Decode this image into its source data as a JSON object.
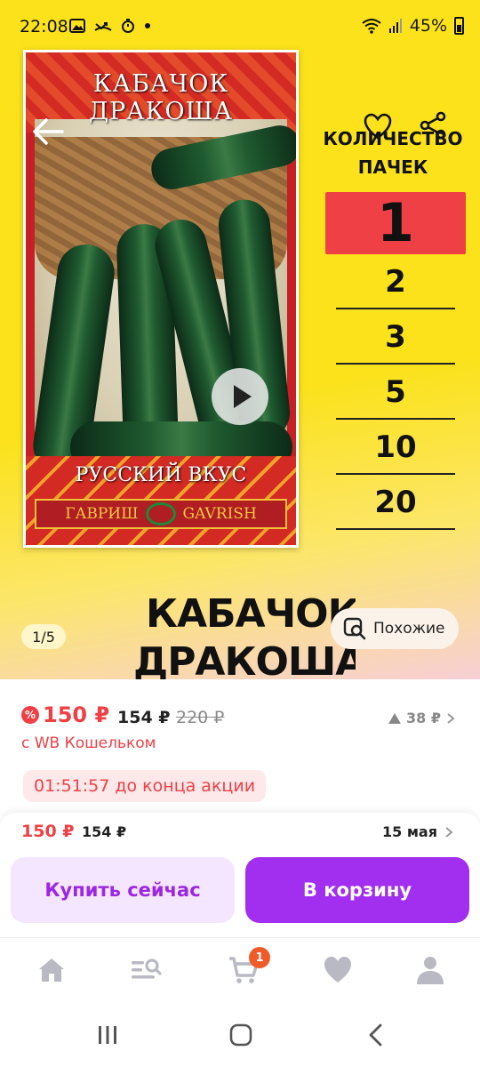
{
  "status_bar": {
    "time": "22:08",
    "battery": "45%"
  },
  "packet": {
    "title_line1": "КАБАЧОК",
    "title_line2": "ДРАКОША",
    "series": "РУССКИЙ ВКУС",
    "brand_ru": "ГАВРИШ",
    "brand_en": "GAVRISH"
  },
  "quantity": {
    "title_line1": "КОЛИЧЕСТВО",
    "title_line2": "ПАЧЕК",
    "options": [
      "1",
      "2",
      "3",
      "5",
      "10",
      "20"
    ],
    "selected": "1"
  },
  "product": {
    "name_line1": "КАБАЧОК",
    "name_line2": "ДРАКОША"
  },
  "gallery": {
    "counter": "1/5"
  },
  "similar_button": {
    "label": "Похожие"
  },
  "price": {
    "wallet_price": "150 ₽",
    "price": "154 ₽",
    "old_price": "220 ₽",
    "wallet_note": "с WB Кошельком",
    "history_change": "38 ₽",
    "promo_timer": "01:51:57 до конца акции"
  },
  "sticky": {
    "wallet_price": "150 ₽",
    "price": "154 ₽",
    "delivery_date": "15 мая",
    "buy_now_label": "Купить сейчас",
    "add_to_cart_label": "В корзину"
  },
  "bottom_nav": {
    "cart_badge": "1"
  },
  "colors": {
    "accent_purple": "#a22ef0",
    "price_red": "#ef4045",
    "hero_yellow": "#fbe21a"
  }
}
